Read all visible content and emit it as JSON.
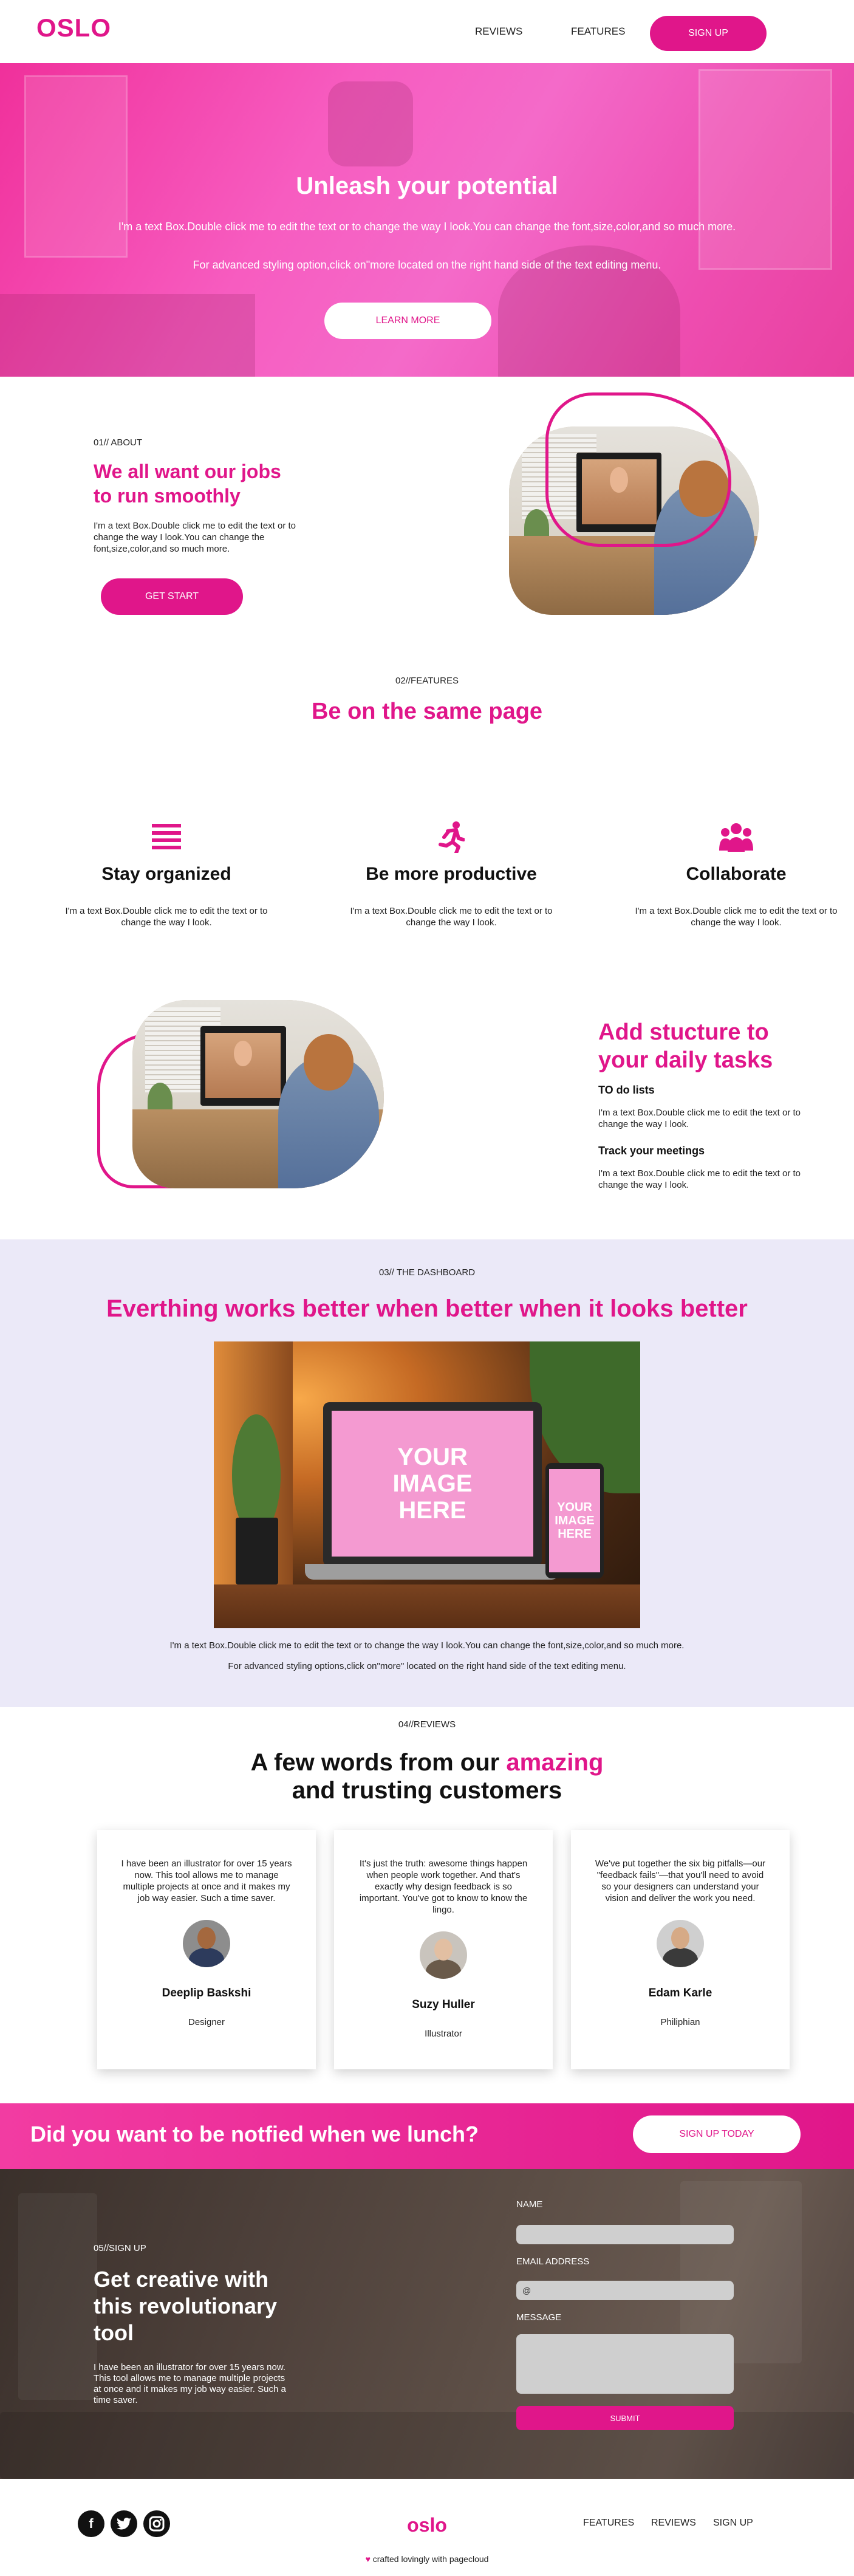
{
  "header": {
    "logo": "OSLO",
    "nav": [
      "REVIEWS",
      "FEATURES"
    ],
    "signup_label": "SIGN UP"
  },
  "hero": {
    "title": "Unleash your potential",
    "text1": "I'm a text Box.Double click me to edit the text or to change the way I look.You can change the font,size,color,and so much more.",
    "text2": "For advanced styling option,click on\"more located on the right hand side of the text editing menu.",
    "button": "LEARN MORE"
  },
  "about": {
    "eyebrow": "01// ABOUT",
    "title": "We all want our jobs to run smoothly",
    "text": "I'm a text Box.Double click me to edit the text or to change the way I look.You can change the font,size,color,and so much more.",
    "button": "GET START"
  },
  "features": {
    "eyebrow": "02//FEATURES",
    "title": "Be on the same page",
    "items": [
      {
        "icon": "list-icon",
        "title": "Stay organized",
        "text": "I'm a text Box.Double click me to edit the text or to change the way I look."
      },
      {
        "icon": "running-icon",
        "title": "Be more productive",
        "text": "I'm a text Box.Double click me to edit the text or to change the way I look."
      },
      {
        "icon": "users-icon",
        "title": "Collaborate",
        "text": "I'm a text Box.Double click me to edit the text or to change the way I look."
      }
    ]
  },
  "structure": {
    "title": "Add stucture to your daily tasks",
    "h1": "TO do lists",
    "p1": "I'm a text Box.Double click me to edit the text or to change the way I look.",
    "h2": "Track your meetings",
    "p2": "I'm a text Box.Double click me to edit the text or to change the way I look."
  },
  "dashboard": {
    "eyebrow": "03// THE DASHBOARD",
    "title": "Everthing works better when better when it looks better",
    "laptop_placeholder": [
      "YOUR",
      "IMAGE",
      "HERE"
    ],
    "phone_placeholder": [
      "YOUR",
      "IMAGE",
      "HERE"
    ],
    "text1": "I'm a text Box.Double click me to edit the text or to change the way I look.You can change the font,size,color,and so much more.",
    "text2": "For advanced styling options,click on\"more\" located on the right hand side of the text editing menu."
  },
  "reviews": {
    "eyebrow": "04//REVIEWS",
    "title_part1": "A few words from our ",
    "title_highlight": "amazing",
    "title_part2": "and trusting customers",
    "cards": [
      {
        "text": "I have been an illustrator for over 15 years now. This tool allows me to manage multiple projects at once and it makes my job way easier. Such a time saver.",
        "name": "Deeplip Baskshi",
        "role": "Designer"
      },
      {
        "text": "It's just the truth: awesome things happen when people work together. And that's exactly why design feedback is so important. You've got to know to know the lingo.",
        "name": "Suzy Huller",
        "role": "Illustrator"
      },
      {
        "text": "We've put together the six big pitfalls—our \"feedback fails\"—that you'll need to avoid so your designers can understand your vision and deliver the work you need.",
        "name": "Edam Karle",
        "role": "Philiphian"
      }
    ]
  },
  "cta": {
    "title": "Did you want to be notfied when we lunch?",
    "button": "SIGN UP TODAY"
  },
  "signup": {
    "eyebrow": "05//SIGN UP",
    "title": "Get creative with this revolutionary tool",
    "text": "I have been an illustrator for over 15 years now. This tool allows me to manage multiple projects at once and it makes my job way easier. Such a time saver.",
    "name_label": "NAME",
    "email_label": "EMAIL ADDRESS",
    "email_value": "@",
    "message_label": "MESSAGE",
    "submit": "SUBMIT"
  },
  "footer": {
    "logo": "oslo",
    "links": [
      "FEATURES",
      "REVIEWS",
      "SIGN UP"
    ],
    "crafted": "crafted lovingly with pagecloud",
    "heart": "♥",
    "social": [
      "facebook-icon",
      "twitter-icon",
      "instagram-icon"
    ]
  },
  "colors": {
    "accent": "#e0168a",
    "lavender": "#ebe9f8"
  }
}
